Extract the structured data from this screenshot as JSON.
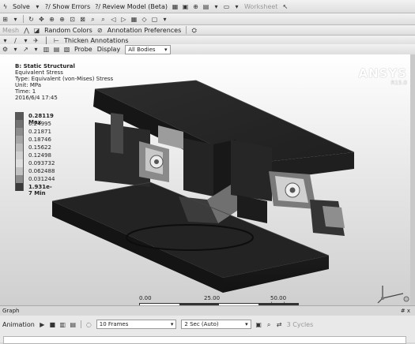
{
  "toolbar1": {
    "solve": "Solve",
    "show_errors": "?/ Show Errors",
    "review_model": "?/ Review Model (Beta)",
    "worksheet": "Worksheet"
  },
  "toolbar2": {
    "mesh": "Mesh",
    "random_colors": "Random Colors",
    "annotation_prefs": "Annotation Preferences"
  },
  "toolbar3": {
    "thicken": "Thicken Annotations"
  },
  "toolbar4": {
    "probe": "Probe",
    "display_label": "Display",
    "display_value": "All Bodies"
  },
  "result": {
    "title": "B: Static Structural",
    "line1": "Equivalent Stress",
    "line2": "Type: Equivalent (von-Mises) Stress",
    "line3": "Unit: MPa",
    "line4": "Time: 1",
    "line5": "2016/6/4 17:45"
  },
  "legend": [
    {
      "label": "0.28119 Max",
      "color": "#585858"
    },
    {
      "label": "0.24995",
      "color": "#727272"
    },
    {
      "label": "0.21871",
      "color": "#8c8c8c"
    },
    {
      "label": "0.18746",
      "color": "#a6a6a6"
    },
    {
      "label": "0.15622",
      "color": "#bcbcbc"
    },
    {
      "label": "0.12498",
      "color": "#d0d0d0"
    },
    {
      "label": "0.093732",
      "color": "#dedede"
    },
    {
      "label": "0.062488",
      "color": "#c2c2c2"
    },
    {
      "label": "0.031244",
      "color": "#8a8a8a"
    },
    {
      "label": "1.931e-7 Min",
      "color": "#3a3a3a"
    }
  ],
  "brand": {
    "name": "ANSYS",
    "version": "R15.0"
  },
  "scale": {
    "t0": "0.00",
    "t1": "25.00",
    "t2": "50.00 (mm)"
  },
  "graph": {
    "title": "Graph",
    "pin": "# x",
    "animation": "Animation",
    "frames": "10 Frames",
    "duration": "2 Sec (Auto)",
    "cycles": "3 Cycles"
  }
}
